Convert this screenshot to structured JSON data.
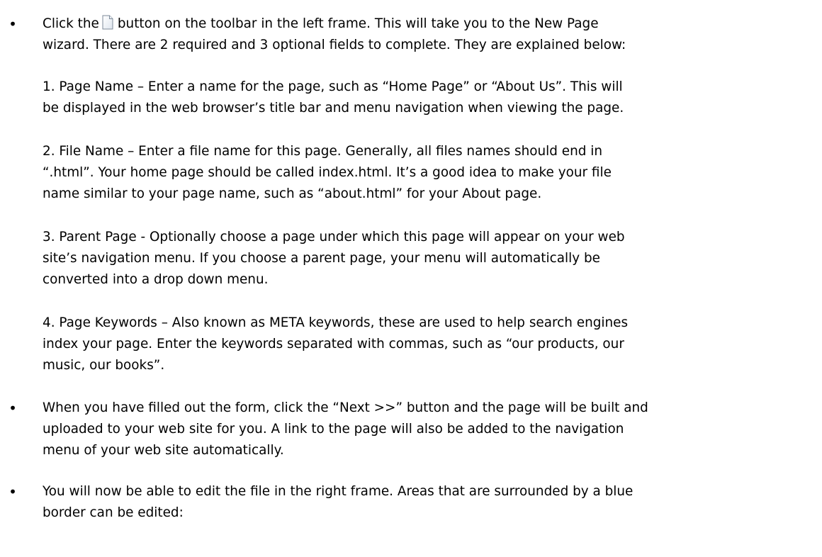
{
  "steps": {
    "step1": {
      "before_icon": "Click the",
      "icon": "new-page-icon",
      "after_icon_line1": "button on the toolbar in the left frame. This will take you to the New Page",
      "line2": "wizard. There are 2 required and 3 optional fields to complete. They are explained below:"
    },
    "fields": [
      {
        "line1": "1. Page Name – Enter a name for the page, such as “Home Page” or “About Us”. This will",
        "line2": "be displayed in the web browser’s title bar and menu navigation when viewing the page."
      },
      {
        "line1": "2. File Name – Enter a file name for this page. Generally, all files names should end in",
        "line2": "“.html”. Your home page should be called index.html. It’s a good idea to make your file",
        "line3": "name similar to your page name, such as “about.html” for your About page."
      },
      {
        "line1": "3. Parent Page - Optionally choose a page under which this page will appear on your web",
        "line2": "site’s navigation menu. If you choose a parent page, your menu will automatically be",
        "line3": "converted into a drop down menu."
      },
      {
        "line1": "4. Page Keywords – Also known as META keywords, these are used to help search engines",
        "line2": "index your page. Enter the keywords separated with commas, such as “our products, our",
        "line3": "music, our books”."
      }
    ],
    "step2": {
      "line1": "When you have filled out the form, click the “Next >>” button and the page will be built and",
      "line2": "uploaded to your web site for you. A link to the page will also be added to the navigation",
      "line3": "menu of your web site automatically."
    },
    "step3": {
      "line1": "You will now be able to edit the file in the right frame. Areas that are surrounded by a blue",
      "line2": "border can be edited:"
    }
  },
  "bullet_char": "•"
}
